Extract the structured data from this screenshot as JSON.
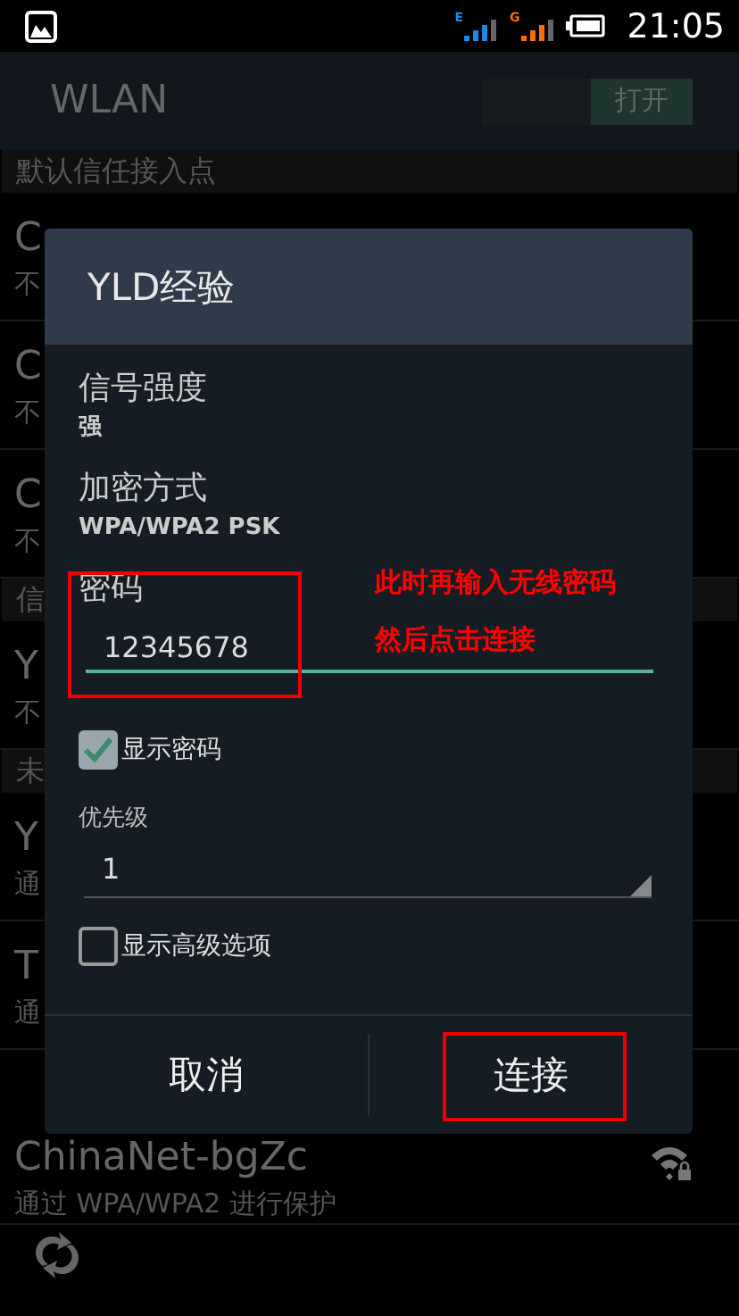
{
  "status_bar": {
    "networks": [
      {
        "label": "E",
        "color": "#1e88e5"
      },
      {
        "label": "G",
        "color": "#ff6d00"
      }
    ],
    "time": "21:05"
  },
  "action_bar": {
    "title": "WLAN",
    "switch": {
      "label": "打开",
      "on": true
    }
  },
  "list": [
    {
      "kind": "header",
      "title": "默认信任接入点"
    },
    {
      "kind": "network",
      "title": "C",
      "subtitle": "不"
    },
    {
      "kind": "network",
      "title": "C",
      "subtitle": "不"
    },
    {
      "kind": "network",
      "title": "C",
      "subtitle": "不"
    },
    {
      "kind": "header",
      "title": "信"
    },
    {
      "kind": "network",
      "title": "Y",
      "subtitle": "不"
    },
    {
      "kind": "header",
      "title": "未"
    },
    {
      "kind": "network",
      "title": "Y",
      "subtitle": "通"
    },
    {
      "kind": "network",
      "title": "T",
      "subtitle": "通"
    },
    {
      "kind": "network",
      "title": "ChinaNet-bgZc",
      "subtitle": "通过 WPA/WPA2 进行保护",
      "signal": true
    }
  ],
  "dialog": {
    "title": "YLD经验",
    "info": [
      {
        "label": "信号强度",
        "value": "强"
      },
      {
        "label": "加密方式",
        "value": "WPA/WPA2 PSK"
      }
    ],
    "password": {
      "label": "密码",
      "value": "12345678"
    },
    "show_password": {
      "label": "显示密码",
      "checked": true
    },
    "priority": {
      "label": "优先级",
      "value": "1"
    },
    "advanced": {
      "label": "显示高级选项",
      "checked": false
    },
    "buttons": [
      "取消",
      "连接"
    ]
  },
  "annotation": {
    "lines": [
      "此时再输入无线密码",
      "然后点击连接"
    ]
  }
}
